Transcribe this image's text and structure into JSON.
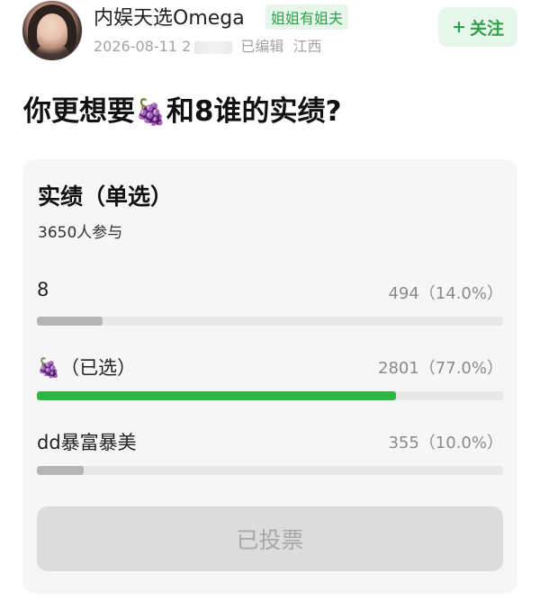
{
  "header": {
    "username": "内娱天选Omega",
    "badge": "姐姐有姐夫",
    "date": "2026-08-11 2",
    "edited": "已编辑",
    "location": "江西",
    "follow_label": "关注",
    "follow_icon": "+"
  },
  "post": {
    "title_before": "你更想要",
    "title_emoji": "🍇",
    "title_after": "和8谁的实绩?"
  },
  "poll": {
    "title": "实绩（单选）",
    "participants": "3650人参与",
    "options": [
      {
        "label": "8",
        "emoji": "",
        "selected_tag": "",
        "count_text": "494（14.0%）",
        "fraction": 0.14,
        "selected": false
      },
      {
        "label": "",
        "emoji": "🍇",
        "selected_tag": "（已选）",
        "count_text": "2801（77.0%）",
        "fraction": 0.77,
        "selected": true
      },
      {
        "label": "dd暴富暴美",
        "emoji": "",
        "selected_tag": "",
        "count_text": "355（10.0%）",
        "fraction": 0.1,
        "selected": false
      }
    ],
    "voted_label": "已投票"
  },
  "colors": {
    "accent_green": "#2db742",
    "badge_bg": "#e6f6ea",
    "card_bg": "#f6f6f6"
  }
}
